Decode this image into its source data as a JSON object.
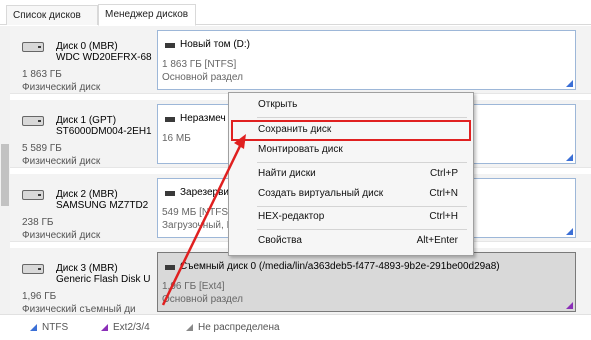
{
  "tabs": [
    {
      "label": "Список дисков"
    },
    {
      "label": "Менеджер дисков"
    }
  ],
  "disks": [
    {
      "name_line1": "Диск 0 (MBR)",
      "name_line2": "WDC WD20EFRX-68",
      "size": "1 863 ГБ",
      "type": "Физический диск",
      "partition": {
        "title": "Новый том (D:)",
        "size": "1 863 ГБ [NTFS]",
        "kind": "Основной раздел",
        "fs": "ntfs"
      }
    },
    {
      "name_line1": "Диск 1 (GPT)",
      "name_line2": "ST6000DM004-2EH1",
      "size": "5 589 ГБ",
      "type": "Физический диск",
      "partition": {
        "title": "Неразмеч",
        "size": "16 МБ",
        "kind": "",
        "fs": "ntfs"
      }
    },
    {
      "name_line1": "Диск 2 (MBR)",
      "name_line2": "SAMSUNG MZ7TD2",
      "size": "238 ГБ",
      "type": "Физический диск",
      "partition": {
        "title": "Зарезерви",
        "size": "549 МБ [NTFS]",
        "kind": "Загрузочный, Р",
        "fs": "ntfs"
      }
    },
    {
      "name_line1": "Диск 3 (MBR)",
      "name_line2": "Generic Flash Disk U",
      "size": "1,96 ГБ",
      "type": "Физический съемный ди",
      "partition": {
        "title": "Съемный диск 0 (/media/lin/a363deb5-f477-4893-9b2e-291be00d29a8)",
        "size": "1,96 ГБ [Ext4]",
        "kind": "Основной раздел",
        "fs": "ext"
      }
    }
  ],
  "context_menu": {
    "open": "Открыть",
    "save_disk": "Сохранить диск",
    "mount_disk": "Монтировать диск",
    "find_disks": "Найти диски",
    "find_disks_shortcut": "Ctrl+P",
    "create_virtual": "Создать виртуальный диск",
    "create_virtual_shortcut": "Ctrl+N",
    "hex_editor": "HEX-редактор",
    "hex_editor_shortcut": "Ctrl+H",
    "properties": "Свойства",
    "properties_shortcut": "Alt+Enter"
  },
  "legend": {
    "ntfs": "NTFS",
    "ext": "Ext2/3/4",
    "unallocated": "Не распределена"
  },
  "colors": {
    "ntfs": "#3b6fd6",
    "ext": "#8b2fb8",
    "annotation": "#e02020"
  }
}
